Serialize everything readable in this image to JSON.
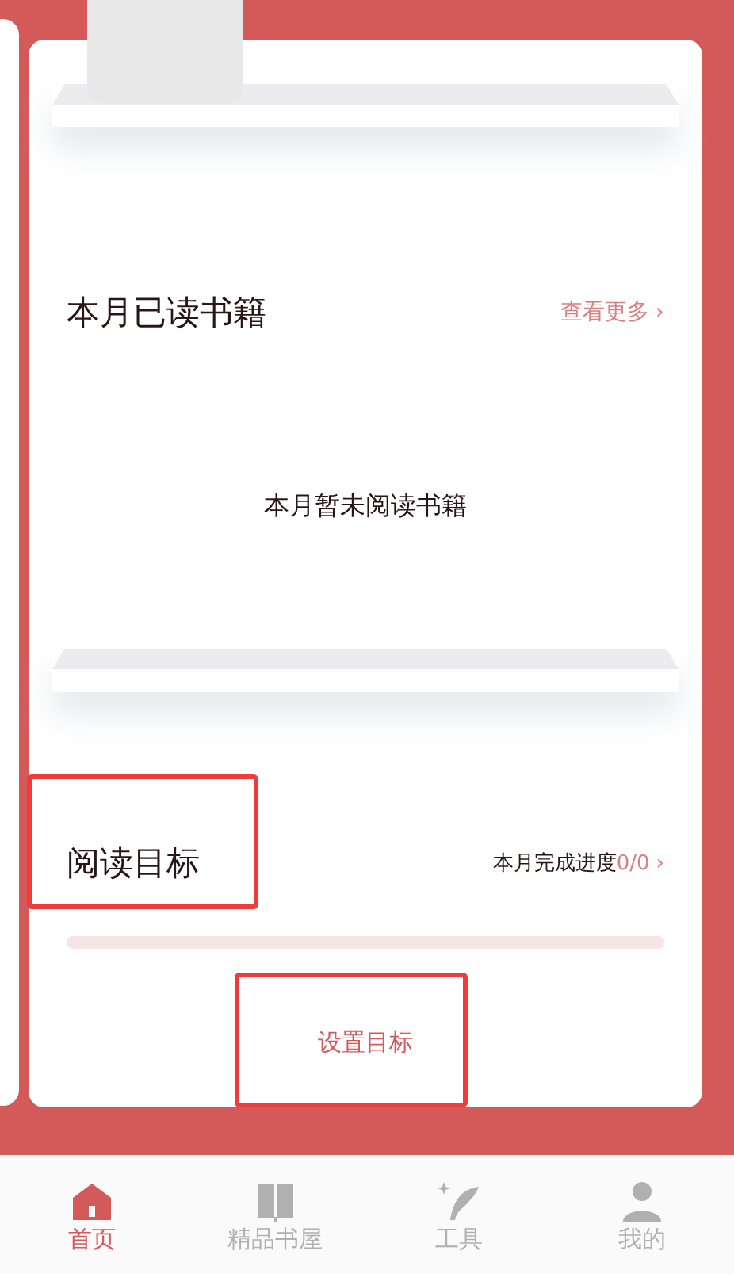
{
  "monthly_books": {
    "title": "本月已读书籍",
    "more_link": "查看更多",
    "more_chevron": "›",
    "empty_message": "本月暂未阅读书籍"
  },
  "reading_goal": {
    "title": "阅读目标",
    "highlighted": true,
    "progress_label": "本月完成进度",
    "progress_value": "0/0",
    "chevron": "›",
    "level": 0
  },
  "set_goal_button": {
    "label": "设置目标",
    "highlighted": true
  },
  "tab_bar": [
    {
      "kind": "home",
      "label": "首页",
      "selected": true
    },
    {
      "kind": "book",
      "label": "精品书屋",
      "selected": false
    },
    {
      "kind": "quill",
      "label": "工具",
      "selected": false
    },
    {
      "kind": "person",
      "label": "我的",
      "selected": false
    }
  ]
}
